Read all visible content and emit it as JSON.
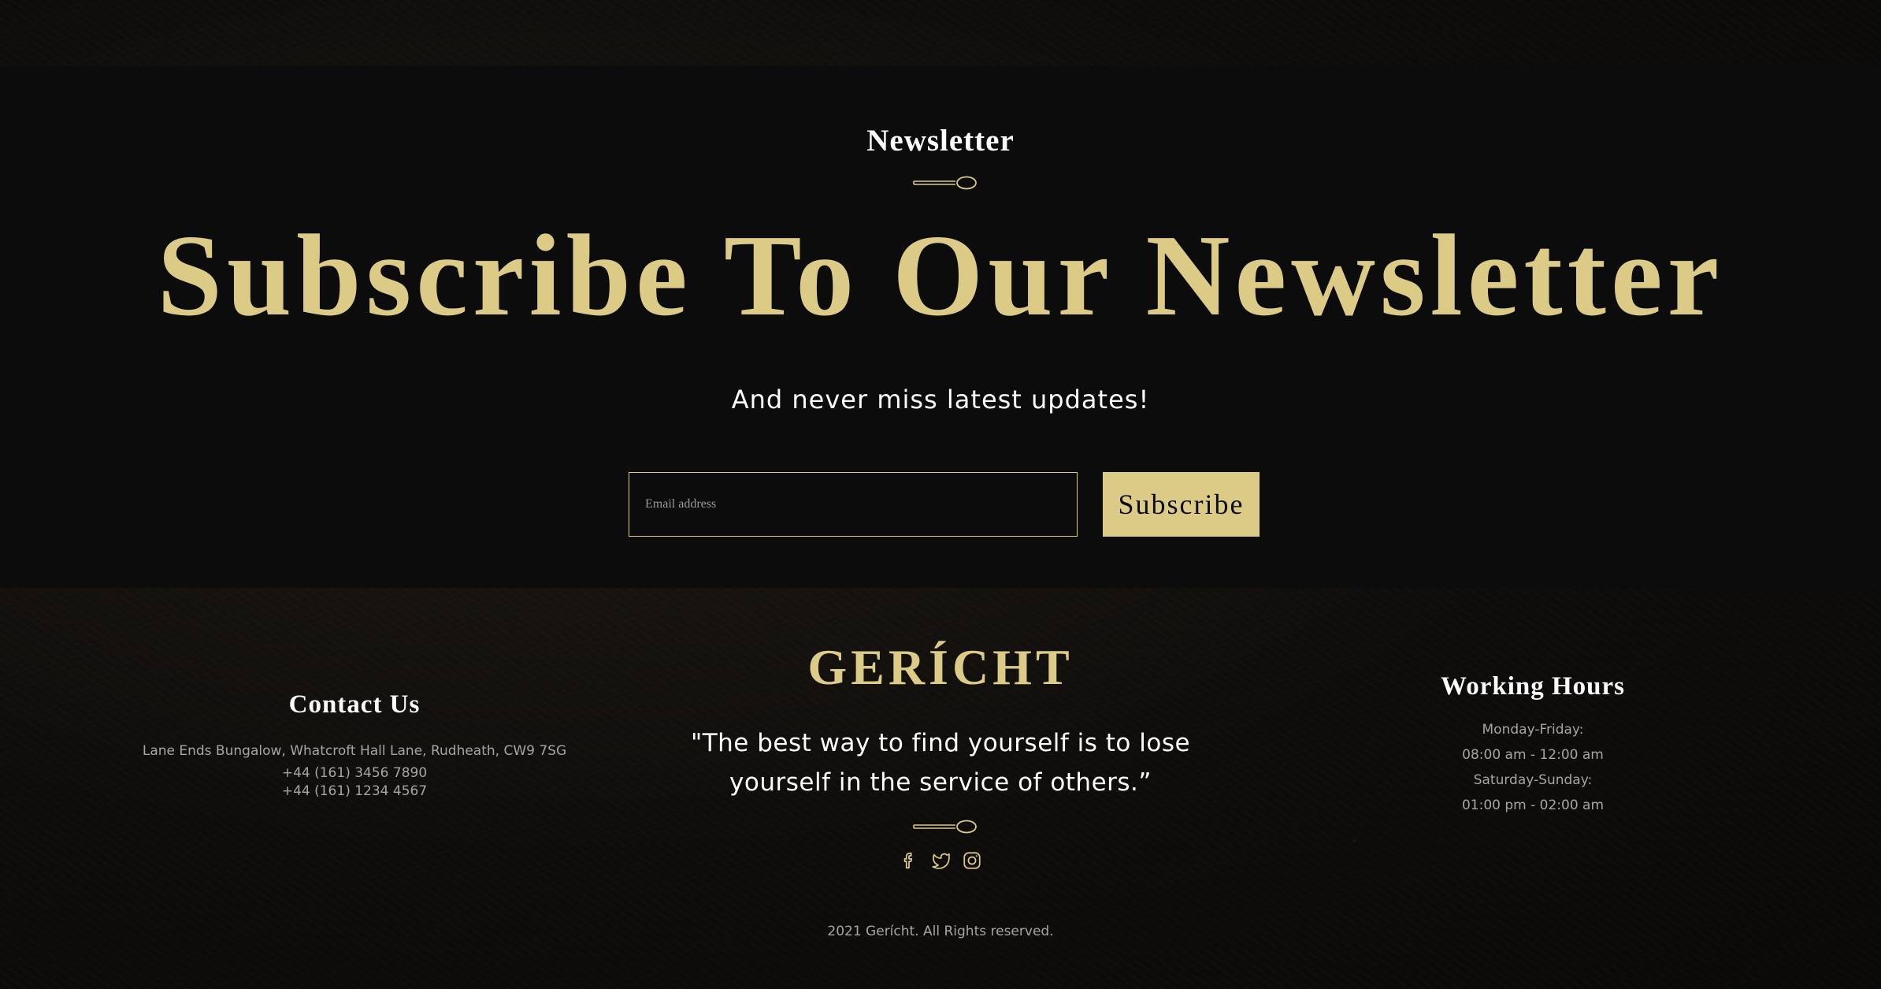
{
  "newsletter": {
    "eyebrow": "Newsletter",
    "headline": "Subscribe To Our Newsletter",
    "subline": "And never miss latest updates!",
    "email_placeholder": "Email address",
    "subscribe_label": "Subscribe"
  },
  "footer": {
    "contact": {
      "title": "Contact Us",
      "address": "Lane Ends Bungalow, Whatcroft Hall Lane, Rudheath, CW9 7SG",
      "phones": [
        "+44 (161) 3456 7890",
        "+44 (161) 1234 4567"
      ]
    },
    "brand": {
      "logo": "GERÍCHT",
      "quote": "\"The best way to find yourself is to lose yourself in the service of others.”"
    },
    "socials": [
      {
        "name": "facebook-icon"
      },
      {
        "name": "twitter-icon"
      },
      {
        "name": "instagram-icon"
      }
    ],
    "hours": {
      "title": "Working Hours",
      "lines": [
        "Monday-Friday:",
        "08:00 am - 12:00 am",
        "Saturday-Sunday:",
        "01:00 pm - 02:00 am"
      ]
    },
    "copyright": "2021 Gerícht. All Rights reserved."
  },
  "colors": {
    "accent_gold": "#dcca87",
    "panel_black": "#0c0c0c",
    "text_white": "#ffffff",
    "text_grey": "#a5a5a5"
  }
}
